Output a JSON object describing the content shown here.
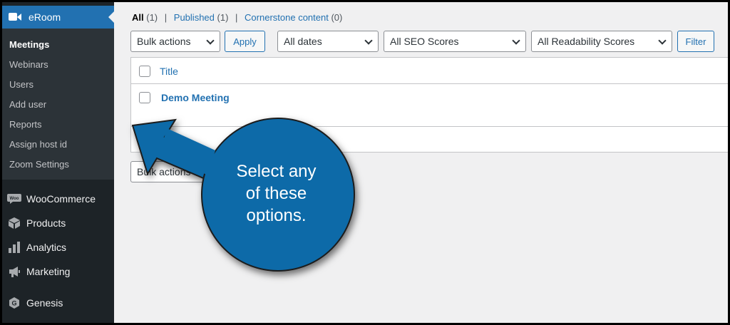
{
  "sidebar": {
    "app_title": "eRoom",
    "submenu": [
      "Meetings",
      "Webinars",
      "Users",
      "Add user",
      "Reports",
      "Assign host id",
      "Zoom Settings"
    ],
    "menu": [
      {
        "label": "WooCommerce",
        "icon": "woocommerce-icon"
      },
      {
        "label": "Products",
        "icon": "box-icon"
      },
      {
        "label": "Analytics",
        "icon": "bar-chart-icon"
      },
      {
        "label": "Marketing",
        "icon": "megaphone-icon"
      },
      {
        "label": "Genesis",
        "icon": "genesis-icon"
      }
    ]
  },
  "filters": {
    "all_label": "All",
    "all_count": "(1)",
    "published_label": "Published",
    "published_count": "(1)",
    "cornerstone_label": "Cornerstone content",
    "cornerstone_count": "(0)",
    "sep": "|"
  },
  "toolbar": {
    "bulk_actions": "Bulk actions",
    "apply": "Apply",
    "dates": "All dates",
    "seo": "All SEO Scores",
    "readability": "All Readability Scores",
    "filter": "Filter"
  },
  "table": {
    "column_title": "Title",
    "rows": [
      {
        "title": "Demo Meeting"
      }
    ]
  },
  "bottom_toolbar": {
    "bulk_actions": "Bulk actions"
  },
  "annotation": {
    "line1": "Select any",
    "line2": "of these",
    "line3": "options.",
    "color": "#0f6ba8"
  },
  "colors": {
    "accent": "#2271b1",
    "sidebar": "#1d2327"
  }
}
